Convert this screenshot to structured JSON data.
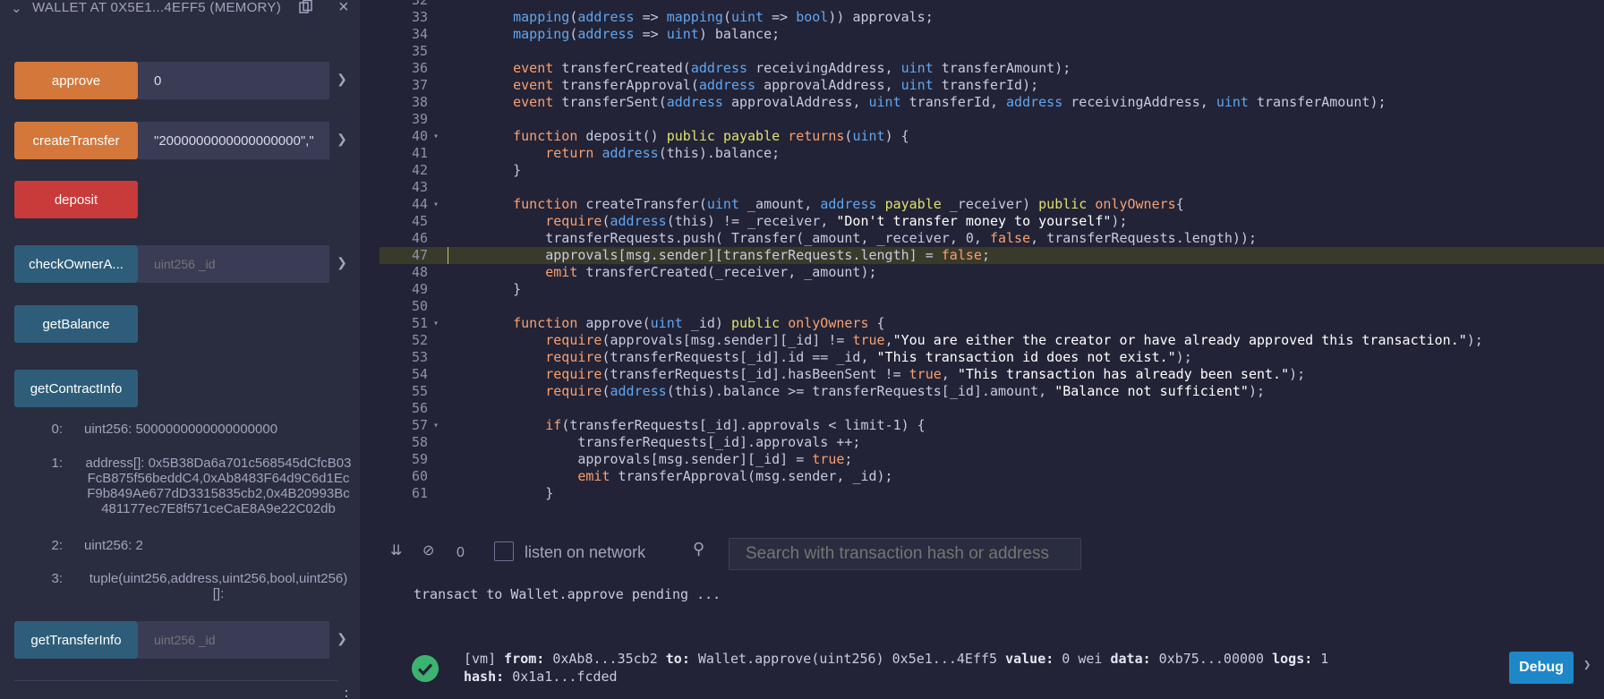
{
  "deploy": {
    "title": "WALLET AT 0X5E1...4EFF5 (MEMORY)",
    "functions": [
      {
        "label": "approve",
        "value": "0",
        "placeholder": ""
      },
      {
        "label": "createTransfer",
        "value": "\"2000000000000000000\",\"",
        "placeholder": ""
      },
      {
        "label": "deposit"
      },
      {
        "label": "checkOwnerA...",
        "value": "",
        "placeholder": "uint256 _id"
      },
      {
        "label": "getBalance"
      },
      {
        "label": "getContractInfo"
      },
      {
        "label": "getTransferInfo",
        "value": "",
        "placeholder": "uint256 _id"
      }
    ],
    "results": [
      {
        "index": "0:",
        "value": "uint256: 5000000000000000000"
      },
      {
        "index": "1:",
        "value": "address[]: 0x5B38Da6a701c568545dCfcB03FcB875f56beddC4,0xAb8483F64d9C6d1EcF9b849Ae677dD3315835cb2,0x4B20993Bc481177ec7E8f571ceCaE8A9e22C02db"
      },
      {
        "index": "2:",
        "value": "uint256: 2"
      },
      {
        "index": "3:",
        "value": "tuple(uint256,address,uint256,bool,uint256)[]:"
      }
    ]
  },
  "editor": {
    "lines": [
      {
        "n": "32",
        "code": ""
      },
      {
        "n": "33",
        "code": "    mapping(address => mapping(uint => bool)) approvals;"
      },
      {
        "n": "34",
        "code": "    mapping(address => uint) balance;"
      },
      {
        "n": "35",
        "code": ""
      },
      {
        "n": "36",
        "code": "    event transferCreated(address receivingAddress, uint transferAmount);"
      },
      {
        "n": "37",
        "code": "    event transferApproval(address approvalAddress, uint transferId);"
      },
      {
        "n": "38",
        "code": "    event transferSent(address approvalAddress, uint transferId, address receivingAddress, uint transferAmount);"
      },
      {
        "n": "39",
        "code": ""
      },
      {
        "n": "40",
        "code": "    function deposit() public payable returns(uint) {",
        "fold": true
      },
      {
        "n": "41",
        "code": "        return address(this).balance;"
      },
      {
        "n": "42",
        "code": "    }"
      },
      {
        "n": "43",
        "code": ""
      },
      {
        "n": "44",
        "code": "    function createTransfer(uint _amount, address payable _receiver) public onlyOwners{",
        "fold": true
      },
      {
        "n": "45",
        "code": "        require(address(this) != _receiver, \"Don't transfer money to yourself\");"
      },
      {
        "n": "46",
        "code": "        transferRequests.push( Transfer(_amount, _receiver, 0, false, transferRequests.length));"
      },
      {
        "n": "47",
        "code": "        approvals[msg.sender][transferRequests.length] = false;",
        "highlight": true
      },
      {
        "n": "48",
        "code": "        emit transferCreated(_receiver, _amount);"
      },
      {
        "n": "49",
        "code": "    }"
      },
      {
        "n": "50",
        "code": ""
      },
      {
        "n": "51",
        "code": "    function approve(uint _id) public onlyOwners {",
        "fold": true
      },
      {
        "n": "52",
        "code": "        require(approvals[msg.sender][_id] != true,\"You are either the creator or have already approved this transaction.\");"
      },
      {
        "n": "53",
        "code": "        require(transferRequests[_id].id == _id, \"This transaction id does not exist.\");"
      },
      {
        "n": "54",
        "code": "        require(transferRequests[_id].hasBeenSent != true, \"This transaction has already been sent.\");"
      },
      {
        "n": "55",
        "code": "        require(address(this).balance >= transferRequests[_id].amount, \"Balance not sufficient\");"
      },
      {
        "n": "56",
        "code": ""
      },
      {
        "n": "57",
        "code": "        if(transferRequests[_id].approvals < limit-1) {",
        "fold": true
      },
      {
        "n": "58",
        "code": "            transferRequests[_id].approvals ++;"
      },
      {
        "n": "59",
        "code": "            approvals[msg.sender][_id] = true;"
      },
      {
        "n": "60",
        "code": "            emit transferApproval(msg.sender, _id);"
      },
      {
        "n": "61",
        "code": "        }"
      }
    ]
  },
  "terminal": {
    "pending_count": "0",
    "listen_label": "listen on network",
    "search_placeholder": "Search with transaction hash or address",
    "pending_message": "transact to Wallet.approve pending ...",
    "tx": {
      "vm": "[vm]",
      "from_label": "from:",
      "from": "0xAb8...35cb2",
      "to_label": "to:",
      "to": "Wallet.approve(uint256) 0x5e1...4Eff5",
      "value_label": "value:",
      "value": "0 wei",
      "data_label": "data:",
      "data": "0xb75...00000",
      "logs_label": "logs:",
      "logs": "1",
      "hash_label": "hash:",
      "hash": "0x1a1...fcded"
    },
    "debug_label": "Debug"
  },
  "colors": {
    "orange": "#d3773a",
    "red": "#c93a3a",
    "blue": "#2e5d7a",
    "success": "#3cb371",
    "debug": "#1e87c8"
  }
}
